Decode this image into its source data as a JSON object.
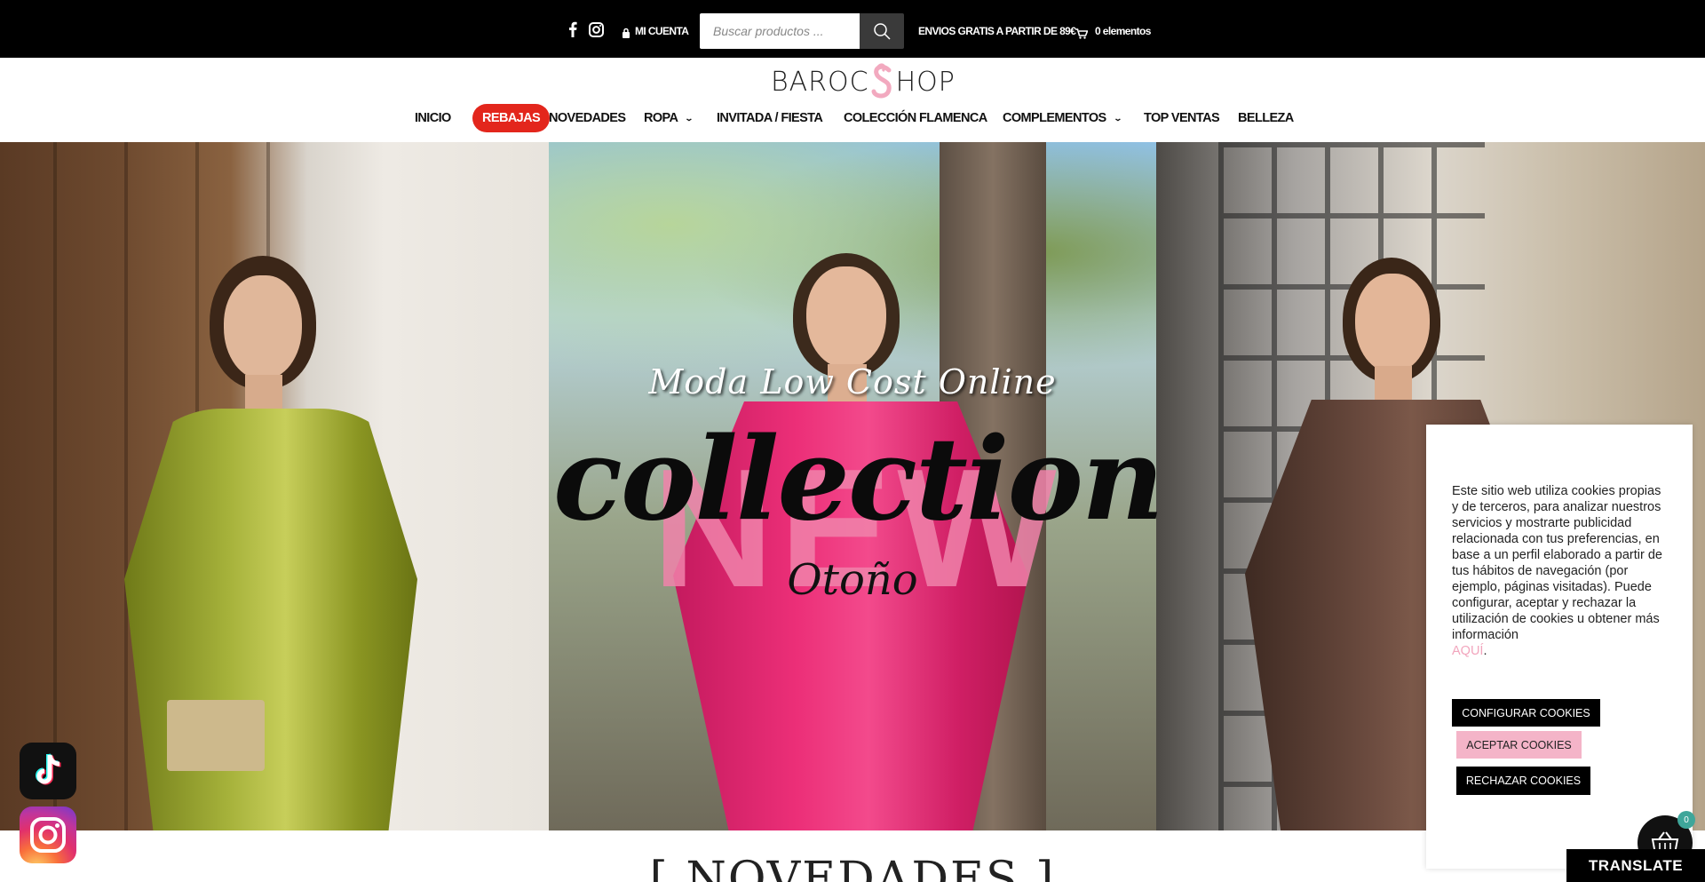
{
  "topbar": {
    "account_label": "MI CUENTA",
    "search_placeholder": "Buscar productos ...",
    "shipping_text": "ENVIOS GRATIS A PARTIR DE 89€",
    "cart_text": "0 elementos"
  },
  "header": {
    "logo_left": "BAROC",
    "logo_right": "HOP",
    "logo_s": "S"
  },
  "nav": {
    "items": [
      {
        "label": "INICIO"
      },
      {
        "label": "REBAJAS"
      },
      {
        "label": "NOVEDADES"
      },
      {
        "label": "ROPA"
      },
      {
        "label": "INVITADA / FIESTA"
      },
      {
        "label": "COLECCIÓN FLAMENCA"
      },
      {
        "label": "COMPLEMENTOS"
      },
      {
        "label": "TOP VENTAS"
      },
      {
        "label": "BELLEZA"
      }
    ]
  },
  "hero": {
    "script_line": "Moda Low Cost Online",
    "big_word": "NEW",
    "collection_word": "collection",
    "season_word": "Otoño"
  },
  "cookie": {
    "text": "Este sitio web utiliza cookies propias y de terceros, para analizar nuestros servicios y mostrarte publicidad relacionada con tus preferencias, en base a un perfil elaborado a partir de tus hábitos de navegación (por ejemplo, páginas visitadas). Puede configurar, aceptar y rechazar la utilización de cookies u obtener más información",
    "link_text": "AQUÍ",
    "configure_label": "CONFIGURAR COOKIES",
    "accept_label": "ACEPTAR COOKIES",
    "reject_label": "RECHAZAR COOKIES"
  },
  "floating": {
    "cart_count": "0",
    "translate_label": "TRANSLATE"
  },
  "section": {
    "title": "NOVEDADES"
  },
  "colors": {
    "topbar_bg": "#000000",
    "sale_red": "#e3261c",
    "pink_accent": "#f4b4c8",
    "badge_teal": "#3fa69a"
  }
}
